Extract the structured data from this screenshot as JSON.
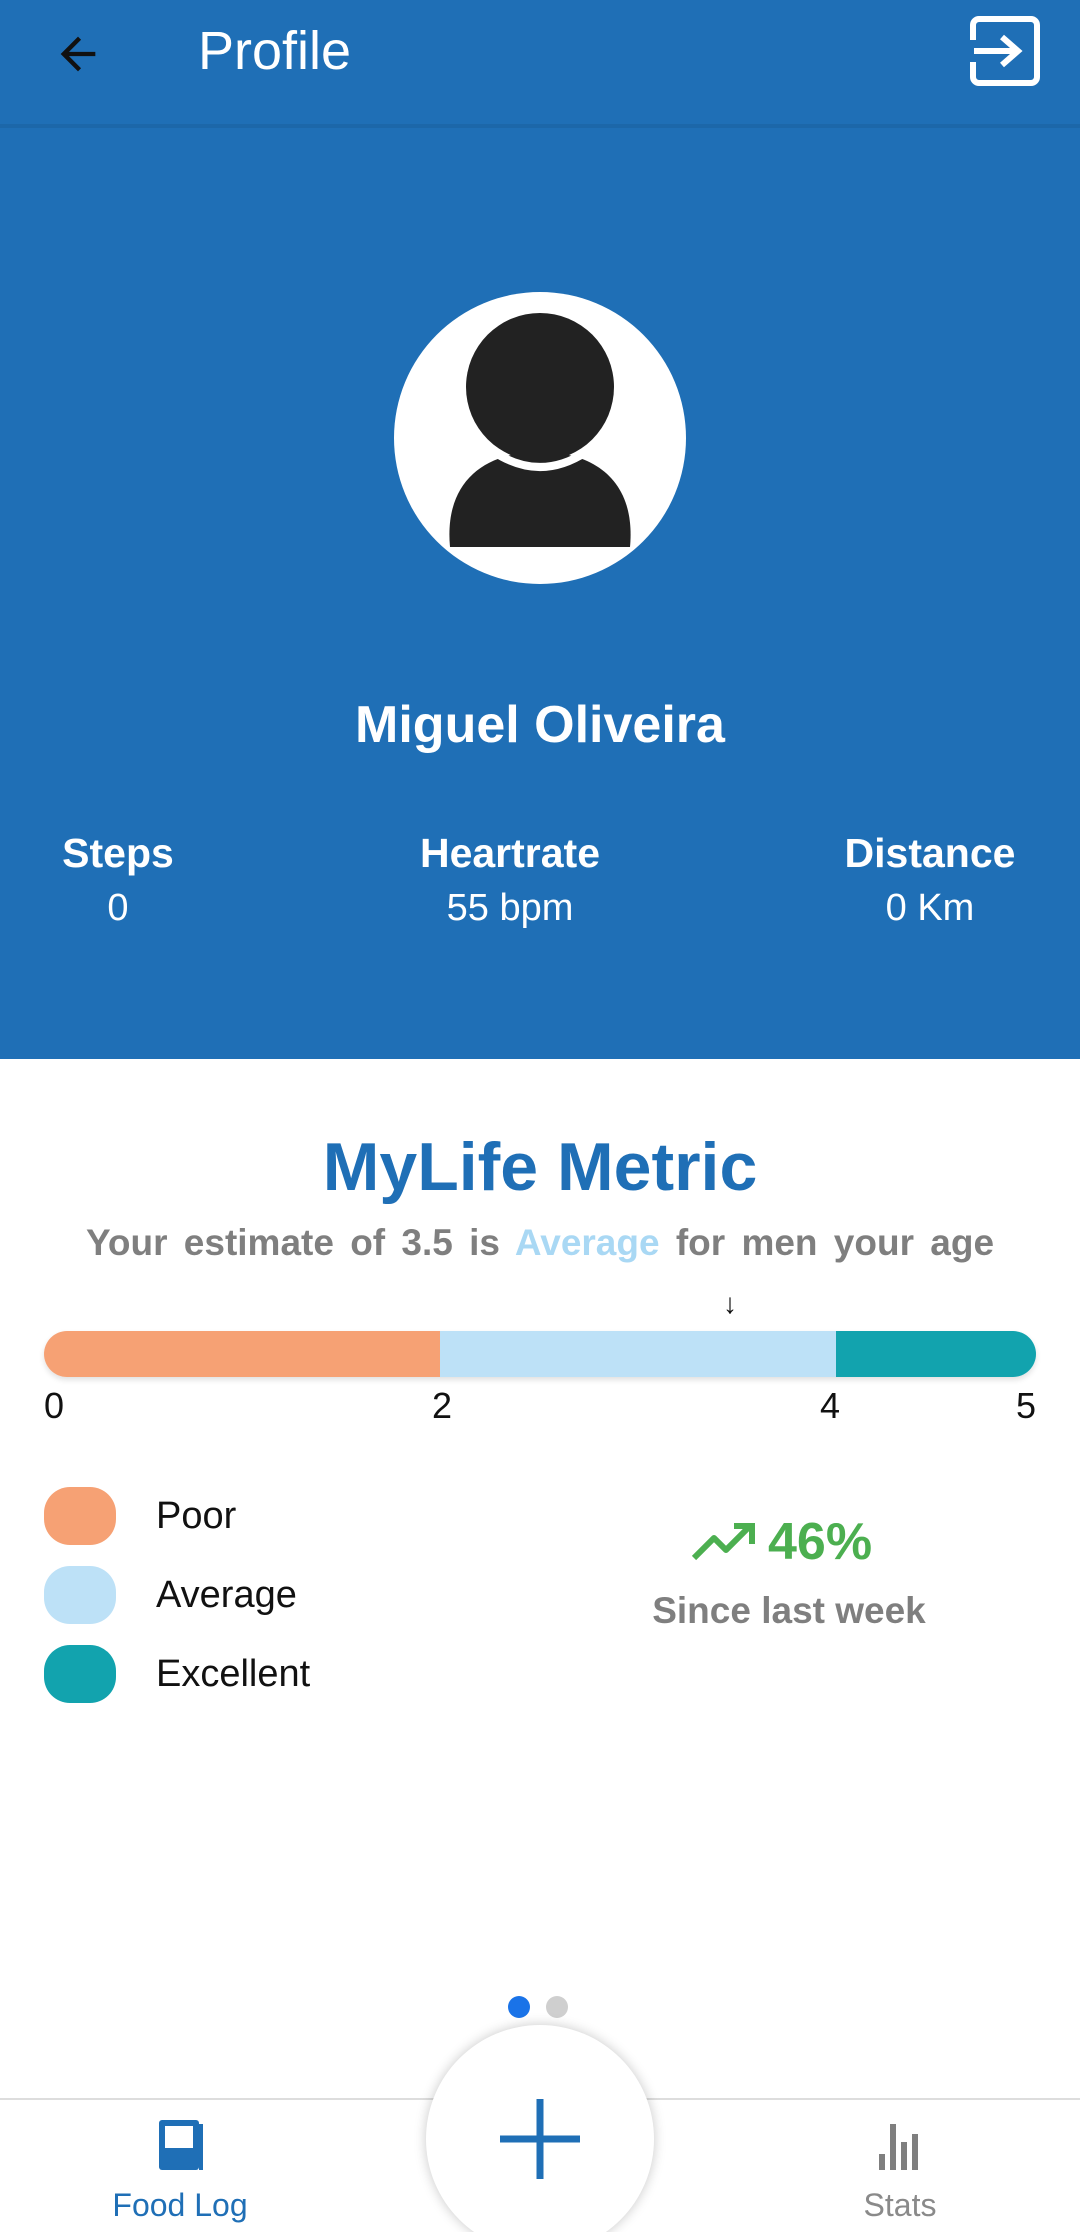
{
  "app_bar": {
    "title": "Profile",
    "back_icon": "arrow-left-icon",
    "logout_icon": "exit-icon"
  },
  "profile": {
    "avatar_icon": "person-icon",
    "name": "Miguel Oliveira",
    "stats": [
      {
        "label": "Steps",
        "value": "0"
      },
      {
        "label": "Heartrate",
        "value": "55 bpm"
      },
      {
        "label": "Distance",
        "value": "0 Km"
      }
    ]
  },
  "metric": {
    "title": "MyLife Metric",
    "subtitle_prefix": "Your estimate of 3.5 is",
    "subtitle_highlight": "Average",
    "subtitle_suffix": "for men your age",
    "marker_symbol": "↓",
    "estimate": 3.5,
    "scale": {
      "min": 0,
      "max": 5,
      "ticks": [
        "0",
        "2",
        "4",
        "5"
      ],
      "segments": [
        {
          "name": "Poor",
          "from": 0,
          "to": 2,
          "color": "#f6a174"
        },
        {
          "name": "Average",
          "from": 2,
          "to": 4,
          "color": "#bde1f7"
        },
        {
          "name": "Excellent",
          "from": 4,
          "to": 5,
          "color": "#12a3ae"
        }
      ]
    },
    "legend": [
      {
        "label": "Poor",
        "color": "#f6a174"
      },
      {
        "label": "Average",
        "color": "#bde1f7"
      },
      {
        "label": "Excellent",
        "color": "#12a3ae"
      }
    ],
    "trend": {
      "icon": "trending-up-icon",
      "value": "46%",
      "caption": "Since last week",
      "color": "#4caf50"
    }
  },
  "pager": {
    "count": 2,
    "active_index": 0,
    "active_color": "#1a73e8",
    "inactive_color": "#cfcfcf"
  },
  "bottom_nav": {
    "items": [
      {
        "label": "Food Log",
        "icon": "book-icon",
        "active": true
      },
      {
        "label": "Stats",
        "icon": "bar-chart-icon",
        "active": false
      }
    ],
    "fab_icon": "plus-icon"
  },
  "colors": {
    "primary": "#1f6fb6",
    "text_grey": "#7f7f7f"
  }
}
